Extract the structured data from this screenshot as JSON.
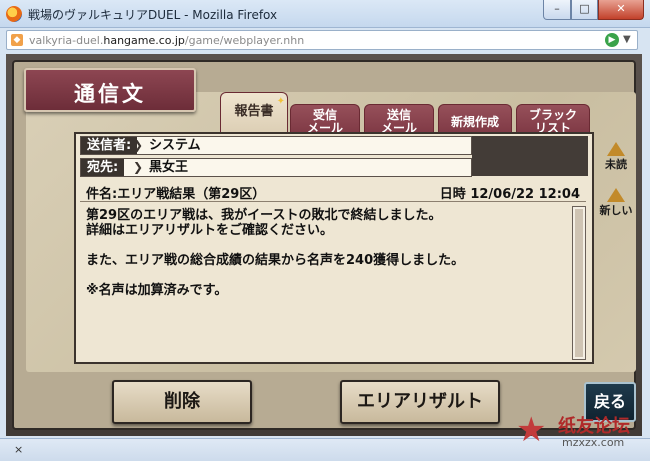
{
  "window": {
    "title": "戦場のヴァルキュリアDUEL - Mozilla Firefox",
    "min_glyph": "–",
    "max_glyph": "□",
    "close_glyph": "✕"
  },
  "urlbar": {
    "url_prefix": "valkyria-duel.",
    "url_domain": "hangame.co.jp",
    "url_path": "/game/webplayer.nhn"
  },
  "statusbar": {
    "close_glyph": "×"
  },
  "screen": {
    "title": "通信文",
    "tabs": [
      {
        "label": "報告書",
        "active": true
      },
      {
        "label": "受信\nメール",
        "active": false
      },
      {
        "label": "送信\nメール",
        "active": false
      },
      {
        "label": "新規作成",
        "active": false
      },
      {
        "label": "ブラック\nリスト",
        "active": false
      }
    ],
    "message": {
      "sender_label": "送信者:",
      "sender_value": "システム",
      "to_label": "宛先:",
      "to_value": "黒女王",
      "subject_label": "件名:",
      "subject_value": "エリア戦結果（第29区）",
      "date_label": "日時",
      "date_value": "12/06/22 12:04",
      "body": [
        "第29区のエリア戦は、我がイーストの敗北で終結しました。",
        "詳細はエリアリザルトをご確認ください。",
        "",
        "また、エリア戦の総合成績の結果から名声を240獲得しました。",
        "",
        "※名声は加算済みです。"
      ]
    },
    "side_buttons": {
      "unread": "未読",
      "new": "新しい"
    },
    "buttons": {
      "delete": "削除",
      "area_result": "エリアリザルト",
      "back": "戻る"
    }
  },
  "watermark": {
    "brand": "纸友论坛",
    "url": "mzxzx.com"
  }
}
